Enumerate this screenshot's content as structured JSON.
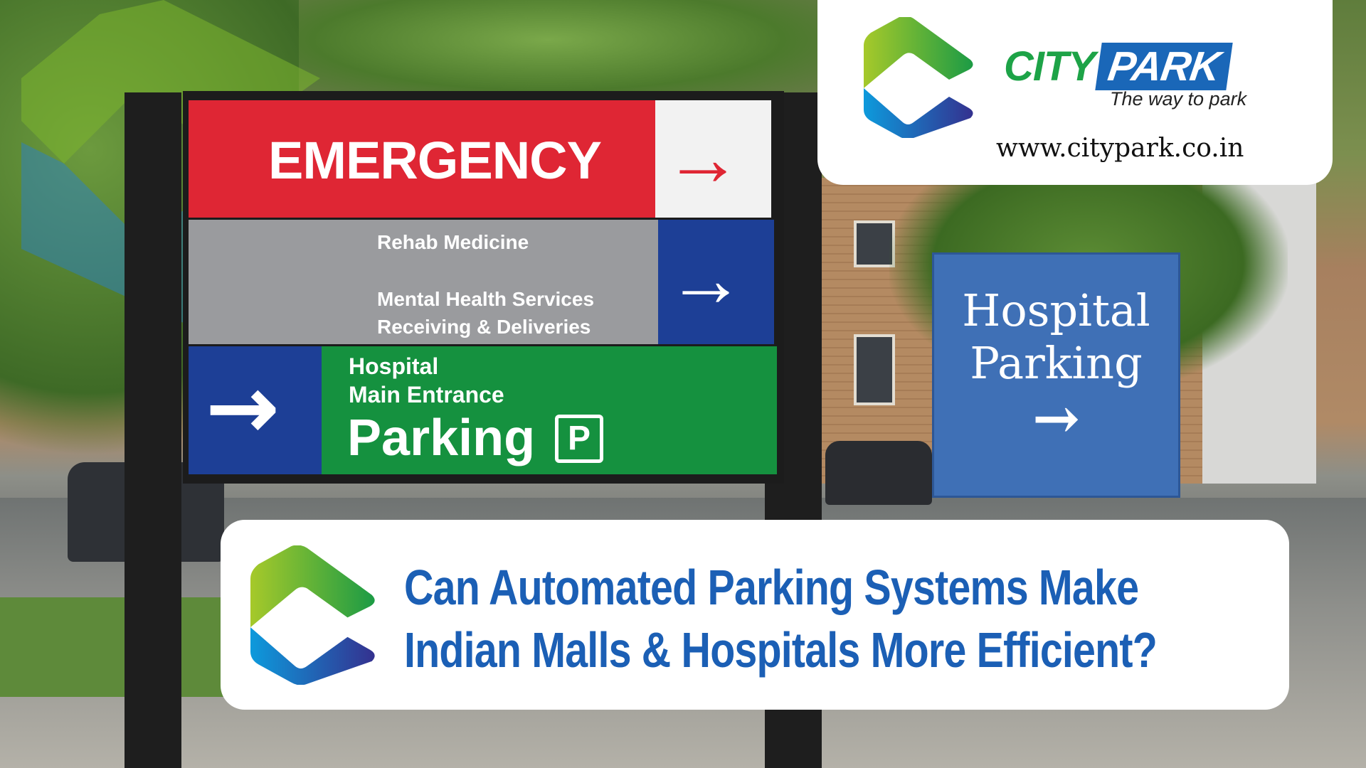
{
  "brand": {
    "name_part1": "CITY",
    "name_part2": "PARK",
    "tagline": "The way to park",
    "website": "www.citypark.co.in",
    "colors": {
      "green": "#1da347",
      "blue": "#1a67b8",
      "title_blue": "#1b5fb5"
    }
  },
  "title": {
    "line1": "Can Automated Parking Systems Make",
    "line2": "Indian Malls & Hospitals More Efficient?"
  },
  "photo": {
    "main_sign": {
      "emergency": "EMERGENCY",
      "rehab": "Rehab Medicine",
      "mental": "Mental Health Services",
      "receiving": "Receiving & Deliveries",
      "hospital": "Hospital",
      "main_entrance": "Main Entrance",
      "parking": "Parking",
      "parking_symbol": "P"
    },
    "side_sign": {
      "line1": "Hospital",
      "line2": "Parking"
    }
  }
}
